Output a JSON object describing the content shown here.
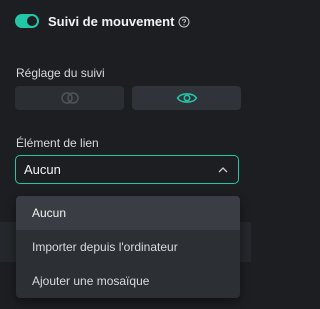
{
  "motion_tracking": {
    "title": "Suivi de mouvement",
    "enabled": true,
    "accent_color": "#22c7a7"
  },
  "tracking_adjust": {
    "label": "Réglage du suivi",
    "options": [
      "toggle-circles-icon",
      "eye-icon"
    ],
    "selected_index": 1
  },
  "link_element": {
    "label": "Élément de lien",
    "selected_value": "Aucun",
    "options": [
      "Aucun",
      "Importer depuis l'ordinateur",
      "Ajouter une mosaïque"
    ]
  }
}
